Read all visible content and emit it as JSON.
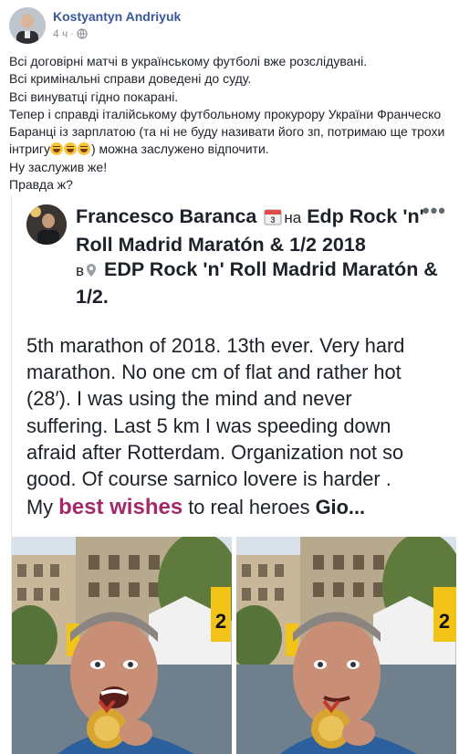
{
  "post": {
    "author": "Kostyantyn Andriyuk",
    "time": "4 ч",
    "separator": "·",
    "privacy_icon": "globe-icon",
    "lines": [
      "Всі договірні матчі в українському футболі вже розслідувані.",
      "Всі кримінальні справи доведені до суду.",
      "Всі винуватці гідно покарані.",
      "Тепер і справді італійському футбольному прокурору України Франческо",
      "Баранці із зарплатою (та ні не буду називати його зп, потримаю ще трохи"
    ],
    "line6_start": "інтригу",
    "line6_end": ") можна заслужено відпочити.",
    "line7": "Ну заслужив же!",
    "line8": "Правда ж?",
    "emoji_name": "laughing-emoji"
  },
  "shared": {
    "name": "Francesco Baranca",
    "calendar_icon": "calendar-icon",
    "on_word": "на",
    "event": "Edp Rock 'n' Roll Madrid Maratón & 1/2 2018",
    "in_word": "в",
    "pin_icon": "location-pin-icon",
    "place": "EDP Rock 'n' Roll Madrid Maratón & 1/2.",
    "more": "•••",
    "body_lines": [
      "5th marathon of 2018. 13th ever. Very hard",
      "marathon. No one cm of flat and rather hot",
      "(28′). I was using the mind and never",
      "suffering. Last 5 km I was speeding down",
      "afraid after Rotterdam. Organization not so",
      "good. Of course sarnico lovere is harder ."
    ],
    "last_prefix": "My ",
    "last_best": "best wishes",
    "last_mid": " to real heroes ",
    "last_gio": "Gio..."
  },
  "colors": {
    "link_blue": "#385898",
    "meta_gray": "#90949c",
    "best_magenta": "#a22a6b"
  }
}
